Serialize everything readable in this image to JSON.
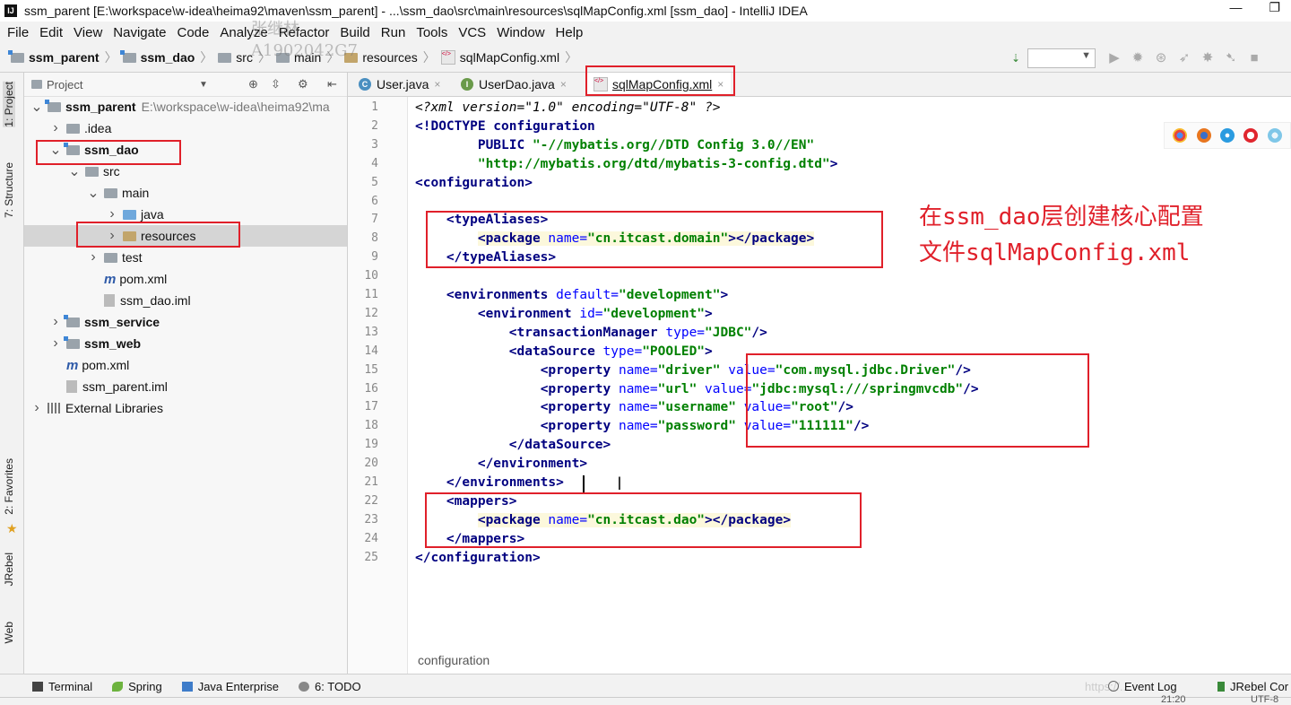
{
  "window": {
    "title": "ssm_parent [E:\\workspace\\w-idea\\heima92\\maven\\ssm_parent] - ...\\ssm_dao\\src\\main\\resources\\sqlMapConfig.xml [ssm_dao] - IntelliJ IDEA",
    "app_icon": "IJ",
    "minimize": "—",
    "restore": "❐"
  },
  "menu": [
    "File",
    "Edit",
    "View",
    "Navigate",
    "Code",
    "Analyze",
    "Refactor",
    "Build",
    "Run",
    "Tools",
    "VCS",
    "Window",
    "Help"
  ],
  "breadcrumb": [
    "ssm_parent",
    "ssm_dao",
    "src",
    "main",
    "resources",
    "sqlMapConfig.xml"
  ],
  "project_panel": {
    "title": "Project",
    "tree": [
      {
        "label": "ssm_parent",
        "path": "E:\\workspace\\w-idea\\heima92\\ma",
        "bold": true,
        "icon": "module-folder",
        "arrow": "▼",
        "indent": 0
      },
      {
        "label": ".idea",
        "icon": "folder",
        "arrow": "▶",
        "indent": 1
      },
      {
        "label": "ssm_dao",
        "icon": "module-folder",
        "arrow": "▼",
        "indent": 1,
        "bold": true
      },
      {
        "label": "src",
        "icon": "folder",
        "arrow": "▼",
        "indent": 2
      },
      {
        "label": "main",
        "icon": "folder",
        "arrow": "▼",
        "indent": 3
      },
      {
        "label": "java",
        "icon": "java-folder",
        "arrow": "▶",
        "indent": 4
      },
      {
        "label": "resources",
        "icon": "resources-folder",
        "arrow": "▶",
        "indent": 4,
        "selected": true
      },
      {
        "label": "test",
        "icon": "folder",
        "arrow": "▶",
        "indent": 3
      },
      {
        "label": "pom.xml",
        "icon": "maven",
        "arrow": "",
        "indent": 3
      },
      {
        "label": "ssm_dao.iml",
        "icon": "iml",
        "arrow": "",
        "indent": 3
      },
      {
        "label": "ssm_service",
        "icon": "module-folder",
        "arrow": "▶",
        "indent": 1,
        "bold": true
      },
      {
        "label": "ssm_web",
        "icon": "module-folder",
        "arrow": "▶",
        "indent": 1,
        "bold": true
      },
      {
        "label": "pom.xml",
        "icon": "maven",
        "arrow": "",
        "indent": 1
      },
      {
        "label": "ssm_parent.iml",
        "icon": "iml",
        "arrow": "",
        "indent": 1
      },
      {
        "label": "External Libraries",
        "icon": "library",
        "arrow": "▶",
        "indent": 0
      }
    ]
  },
  "left_strip": {
    "project": "1: Project",
    "structure": "7: Structure",
    "favorites": "2: Favorites",
    "jrebel": "JRebel",
    "web": "Web"
  },
  "tabs": [
    {
      "label": "User.java",
      "icon": "C"
    },
    {
      "label": "UserDao.java",
      "icon": "I"
    },
    {
      "label": "sqlMapConfig.xml",
      "icon": "xml",
      "active": true
    }
  ],
  "code": {
    "lines": [
      [
        [
          "pi",
          "<?xml version=\"1.0\" encoding=\"UTF-8\" ?>"
        ]
      ],
      [
        [
          "tg",
          "<!DOCTYPE configuration"
        ]
      ],
      [
        [
          "t",
          "        "
        ],
        [
          "tg",
          "PUBLIC "
        ],
        [
          "av",
          "\"-//mybatis.org//DTD Config 3.0//EN\""
        ]
      ],
      [
        [
          "t",
          "        "
        ],
        [
          "av",
          "\"http://mybatis.org/dtd/mybatis-3-config.dtd\""
        ],
        [
          "tg",
          ">"
        ]
      ],
      [
        [
          "tg",
          "<configuration>"
        ]
      ],
      [
        [
          "t",
          ""
        ]
      ],
      [
        [
          "t",
          "    "
        ],
        [
          "tg",
          "<typeAliases>"
        ]
      ],
      [
        [
          "t",
          "        "
        ],
        [
          "tg",
          "<package "
        ],
        [
          "an",
          "name="
        ],
        [
          "av",
          "\"cn.itcast.domain\""
        ],
        [
          "tg",
          "></package>"
        ]
      ],
      [
        [
          "t",
          "    "
        ],
        [
          "tg",
          "</typeAliases>"
        ]
      ],
      [
        [
          "t",
          ""
        ]
      ],
      [
        [
          "t",
          "    "
        ],
        [
          "tg",
          "<environments "
        ],
        [
          "an",
          "default="
        ],
        [
          "av",
          "\"development\""
        ],
        [
          "tg",
          ">"
        ]
      ],
      [
        [
          "t",
          "        "
        ],
        [
          "tg",
          "<environment "
        ],
        [
          "an",
          "id="
        ],
        [
          "av",
          "\"development\""
        ],
        [
          "tg",
          ">"
        ]
      ],
      [
        [
          "t",
          "            "
        ],
        [
          "tg",
          "<transactionManager "
        ],
        [
          "an",
          "type="
        ],
        [
          "av",
          "\"JDBC\""
        ],
        [
          "tg",
          "/>"
        ]
      ],
      [
        [
          "t",
          "            "
        ],
        [
          "tg",
          "<dataSource "
        ],
        [
          "an",
          "type="
        ],
        [
          "av",
          "\"POOLED\""
        ],
        [
          "tg",
          ">"
        ]
      ],
      [
        [
          "t",
          "                "
        ],
        [
          "tg",
          "<property "
        ],
        [
          "an",
          "name="
        ],
        [
          "av",
          "\"driver\" "
        ],
        [
          "an",
          "value="
        ],
        [
          "av",
          "\"com.mysql.jdbc.Driver\""
        ],
        [
          "tg",
          "/>"
        ]
      ],
      [
        [
          "t",
          "                "
        ],
        [
          "tg",
          "<property "
        ],
        [
          "an",
          "name="
        ],
        [
          "av",
          "\"url\" "
        ],
        [
          "an",
          "value="
        ],
        [
          "av",
          "\"jdbc:mysql:///springmvcdb\""
        ],
        [
          "tg",
          "/>"
        ]
      ],
      [
        [
          "t",
          "                "
        ],
        [
          "tg",
          "<property "
        ],
        [
          "an",
          "name="
        ],
        [
          "av",
          "\"username\" "
        ],
        [
          "an",
          "value="
        ],
        [
          "av",
          "\"root\""
        ],
        [
          "tg",
          "/>"
        ]
      ],
      [
        [
          "t",
          "                "
        ],
        [
          "tg",
          "<property "
        ],
        [
          "an",
          "name="
        ],
        [
          "av",
          "\"password\" "
        ],
        [
          "an",
          "value="
        ],
        [
          "av",
          "\"111111\""
        ],
        [
          "tg",
          "/>"
        ]
      ],
      [
        [
          "t",
          "            "
        ],
        [
          "tg",
          "</dataSource>"
        ]
      ],
      [
        [
          "t",
          "        "
        ],
        [
          "tg",
          "</environment>"
        ]
      ],
      [
        [
          "t",
          "    "
        ],
        [
          "tg",
          "</environments>"
        ]
      ],
      [
        [
          "t",
          "    "
        ],
        [
          "tg",
          "<mappers>"
        ]
      ],
      [
        [
          "t",
          "        "
        ],
        [
          "tg",
          "<package "
        ],
        [
          "an",
          "name="
        ],
        [
          "av",
          "\"cn.itcast.dao\""
        ],
        [
          "tg",
          "></package>"
        ]
      ],
      [
        [
          "t",
          "    "
        ],
        [
          "tg",
          "</mappers>"
        ]
      ],
      [
        [
          "tg",
          "</configuration>"
        ]
      ]
    ]
  },
  "annotation": {
    "line1": "在ssm_dao层创建核心配置",
    "line2": "文件sqlMapConfig.xml"
  },
  "editor_breadcrumb": "configuration",
  "watermarks": {
    "name": "张继林",
    "id": "A1902042G7"
  },
  "bottom_tools": [
    "Terminal",
    "Spring",
    "Java Enterprise",
    "6: TODO"
  ],
  "bottom_right": {
    "event_log": "Event Log",
    "jrebel": "JRebel Cor",
    "url_watermark": "https://..."
  },
  "status": {
    "position": "21:20",
    "encoding": "UTF-8"
  },
  "colors": {
    "annotation": "#e0202a",
    "tag": "#000080",
    "attr_value": "#008000",
    "attr_name": "#0000ff"
  }
}
